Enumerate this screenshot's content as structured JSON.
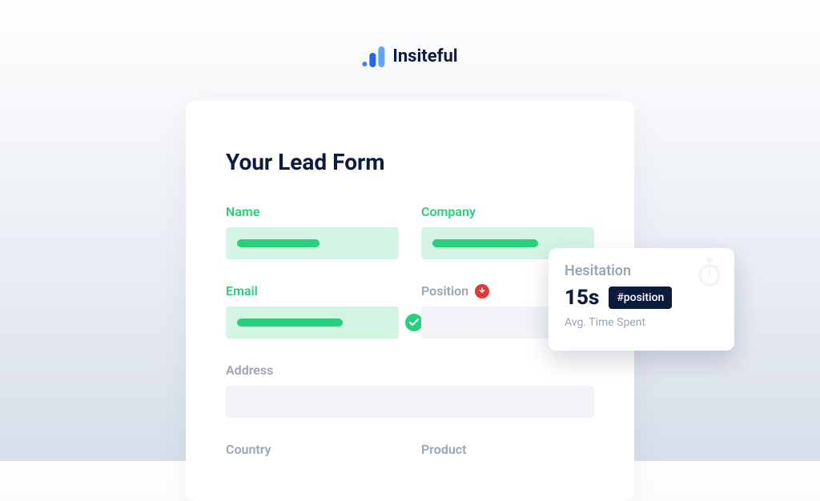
{
  "brand": {
    "name": "Insiteful"
  },
  "form": {
    "title": "Your Lead Form",
    "fields": {
      "name": {
        "label": "Name",
        "status": "filled"
      },
      "company": {
        "label": "Company",
        "status": "filled"
      },
      "email": {
        "label": "Email",
        "status": "valid"
      },
      "position": {
        "label": "Position",
        "status": "error"
      },
      "address": {
        "label": "Address",
        "status": "empty"
      },
      "country": {
        "label": "Country",
        "status": "empty"
      },
      "product": {
        "label": "Product",
        "status": "empty"
      }
    }
  },
  "tooltip": {
    "title": "Hesitation",
    "value": "15s",
    "selector": "#position",
    "sub": "Avg. Time Spent"
  }
}
